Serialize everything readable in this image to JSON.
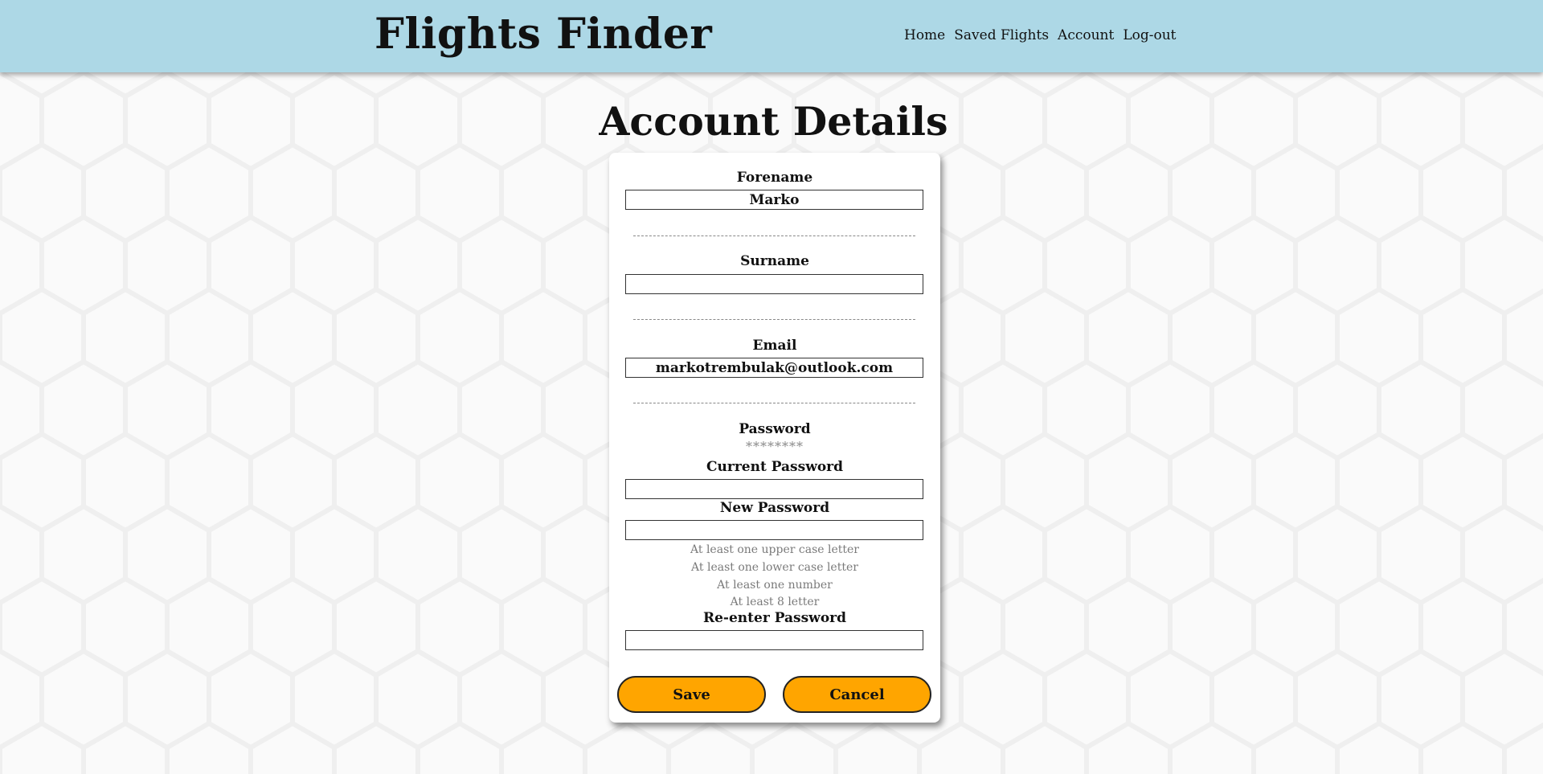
{
  "header": {
    "title": "Flights Finder",
    "nav": [
      "Home",
      "Saved Flights",
      "Account",
      "Log-out"
    ]
  },
  "page": {
    "heading": "Account Details"
  },
  "form": {
    "forename_label": "Forename",
    "forename_value": "Marko",
    "surname_label": "Surname",
    "surname_value": "",
    "email_label": "Email",
    "email_value": "markotrembulak@outlook.com",
    "password_label": "Password",
    "password_masked": "********",
    "current_password_label": "Current Password",
    "current_password_value": "",
    "new_password_label": "New Password",
    "new_password_value": "",
    "requirements": [
      "At least one upper case letter",
      "At least one lower case letter",
      "At least one number",
      "At least 8 letter"
    ],
    "reenter_password_label": "Re-enter Password",
    "reenter_password_value": "",
    "save_label": "Save",
    "cancel_label": "Cancel"
  },
  "colors": {
    "header_bg": "#add8e6",
    "button_bg": "#ffa500",
    "card_bg": "#ffffff"
  }
}
